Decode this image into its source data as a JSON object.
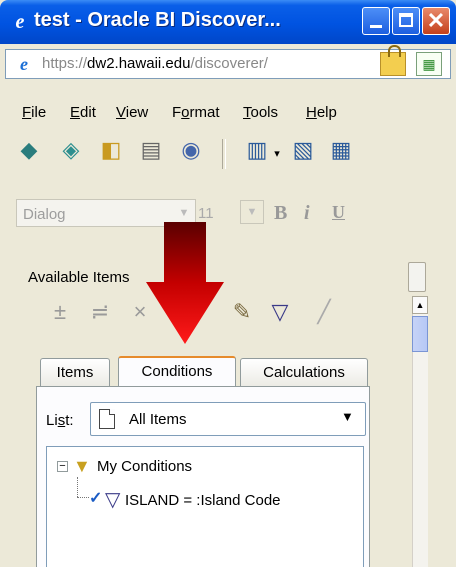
{
  "window": {
    "title": "test - Oracle BI Discover...",
    "icon": "ie-e-icon",
    "buttons": [
      "minimize",
      "maximize",
      "close"
    ]
  },
  "address_bar": {
    "prefix": "https://",
    "domain": "dw2.hawaii.edu",
    "path": "/discoverer/"
  },
  "menu": [
    "File",
    "Edit",
    "View",
    "Format",
    "Tools",
    "Help"
  ],
  "toolbar_icons": [
    "new-workbook-icon",
    "open-icon",
    "save-icon",
    "print-icon",
    "print-preview-icon",
    "table-layout-icon",
    "edit-sheet-icon",
    "table-icon"
  ],
  "format_toolbar": {
    "font": "Dialog",
    "size": "11",
    "bold": "B",
    "italic": "i",
    "underline": "U"
  },
  "panel": {
    "available_items_label": "Available Items"
  },
  "tabs": [
    {
      "label": "Items"
    },
    {
      "label": "Conditions"
    },
    {
      "label": "Calculations"
    }
  ],
  "list_control": {
    "label_prefix": "Li",
    "label_underlined": "s",
    "label_suffix": "t:",
    "value": "All Items"
  },
  "tree": {
    "folder": "My Conditions",
    "condition": "ISLAND = :Island Code"
  },
  "colors": {
    "title_bar": "#0053e1",
    "selected_tab_accent": "#e68b2c",
    "arrow": "#ff0000"
  }
}
